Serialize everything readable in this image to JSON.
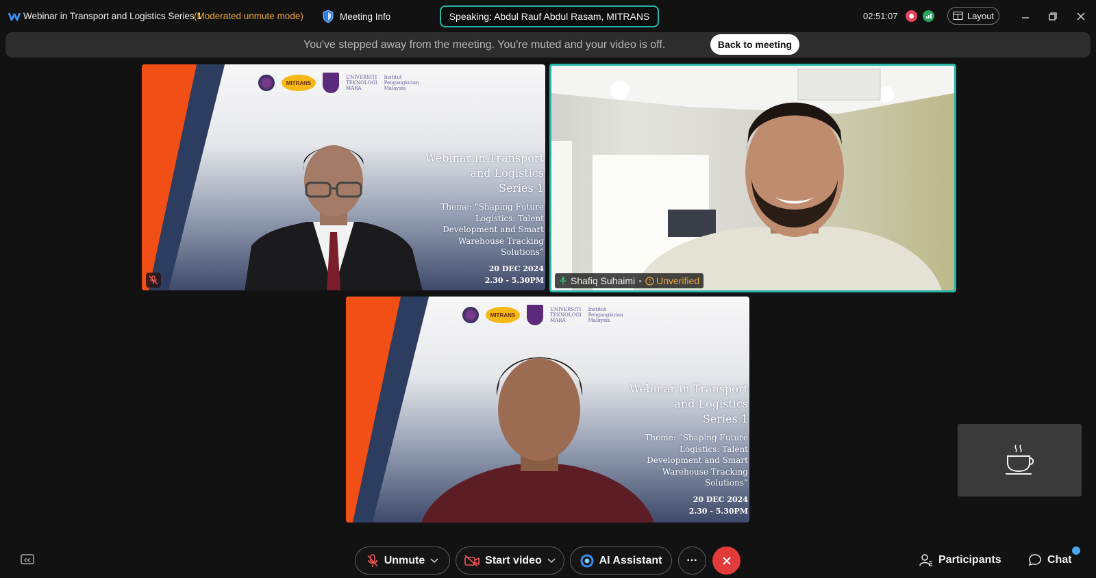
{
  "window": {
    "title": "Webinar in Transport and Logistics Series 1",
    "mode": "(Moderated unmute mode)",
    "meeting_info": "Meeting Info",
    "speaking": "Speaking: Abdul Rauf Abdul Rasam, MITRANS",
    "elapsed": "02:51:07",
    "layout": "Layout"
  },
  "banner": {
    "message": "You've stepped away from the meeting. You're muted and your video is off.",
    "back_button": "Back to meeting"
  },
  "slide": {
    "title_lines": [
      "Webinar in Transport",
      "and Logistics",
      "Series 1"
    ],
    "theme_lines": [
      "Theme: “Shaping Future",
      "Logistics: Talent",
      "Development and Smart",
      "Warehouse Tracking",
      "Solutions”"
    ],
    "date": "20 DEC 2024",
    "time": "2.30 - 5.30PM",
    "logo_mitrans": "MITRANS",
    "logo_uitm_lines": [
      "UNIVERSITI",
      "TEKNOLOGI",
      "MARA"
    ],
    "logo_institute_lines": [
      "Institut",
      "Pengangkutan",
      "Malaysia"
    ]
  },
  "participants": {
    "second": {
      "name": "Shafiq Suhaimi",
      "status": "Unverified"
    }
  },
  "toolbar": {
    "unmute": "Unmute",
    "start_video": "Start video",
    "ai_assistant": "AI Assistant",
    "more": "···",
    "participants": "Participants",
    "chat": "Chat"
  },
  "colors": {
    "speaking_border": "#27b5a8",
    "warning": "#f0a93c",
    "end_call": "#e23b3b",
    "active_tile_border": "#27b5a8"
  }
}
